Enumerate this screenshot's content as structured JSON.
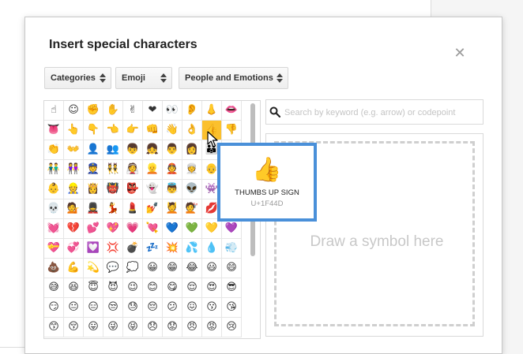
{
  "dialog": {
    "title": "Insert special characters",
    "close_glyph": "✕"
  },
  "filters": {
    "category_select": "Categories",
    "type_select": "Emoji",
    "subcategory_select": "People and Emotions"
  },
  "search": {
    "placeholder": "Search by keyword (e.g. arrow) or codepoint",
    "value": ""
  },
  "draw": {
    "label": "Draw a symbol here"
  },
  "tooltip": {
    "glyph": "👍",
    "name": "THUMBS UP SIGN",
    "codepoint": "U+1F44D"
  },
  "emoji_grid": {
    "selected_row": 1,
    "selected_col": 8,
    "rows": [
      [
        "☝",
        "☺",
        "✊",
        "✋",
        "✌",
        "❤",
        "👀",
        "👂",
        "👃",
        "👄"
      ],
      [
        "👅",
        "👆",
        "👇",
        "👈",
        "👉",
        "👊",
        "👋",
        "👌",
        "👍",
        "👎"
      ],
      [
        "👏",
        "👐",
        "👤",
        "👥",
        "👦",
        "👧",
        "👨",
        "👩",
        "👪",
        "👫"
      ],
      [
        "👬",
        "👭",
        "👮",
        "👯",
        "👰",
        "👱",
        "👲",
        "👳",
        "👴",
        "👵"
      ],
      [
        "👶",
        "👷",
        "👸",
        "👹",
        "👺",
        "👻",
        "👼",
        "👽",
        "👾",
        "👿"
      ],
      [
        "💀",
        "💁",
        "💂",
        "💃",
        "💄",
        "💅",
        "💆",
        "💇",
        "💋",
        "💌"
      ],
      [
        "💓",
        "💔",
        "💕",
        "💖",
        "💗",
        "💘",
        "💙",
        "💚",
        "💛",
        "💜"
      ],
      [
        "💝",
        "💞",
        "💟",
        "💢",
        "💣",
        "💤",
        "💥",
        "💦",
        "💧",
        "💨"
      ],
      [
        "💩",
        "💪",
        "💫",
        "💬",
        "💭",
        "😀",
        "😁",
        "😂",
        "😃",
        "😄"
      ],
      [
        "😅",
        "😆",
        "😇",
        "😈",
        "😉",
        "😊",
        "😋",
        "😌",
        "😍",
        "😎"
      ],
      [
        "😏",
        "😐",
        "😑",
        "😒",
        "😓",
        "😔",
        "😕",
        "😖",
        "😗",
        "😘"
      ],
      [
        "😙",
        "😚",
        "😛",
        "😜",
        "😝",
        "😞",
        "😟",
        "😠",
        "😡",
        "😢"
      ]
    ]
  },
  "icons": {
    "close": "close-icon",
    "search": "search-icon",
    "dropdown": "chevron-up-down-icon",
    "cursor": "mouse-pointer-icon"
  },
  "colors": {
    "selected_cell": "#fbc02d",
    "tooltip_border": "#4a90d9"
  }
}
